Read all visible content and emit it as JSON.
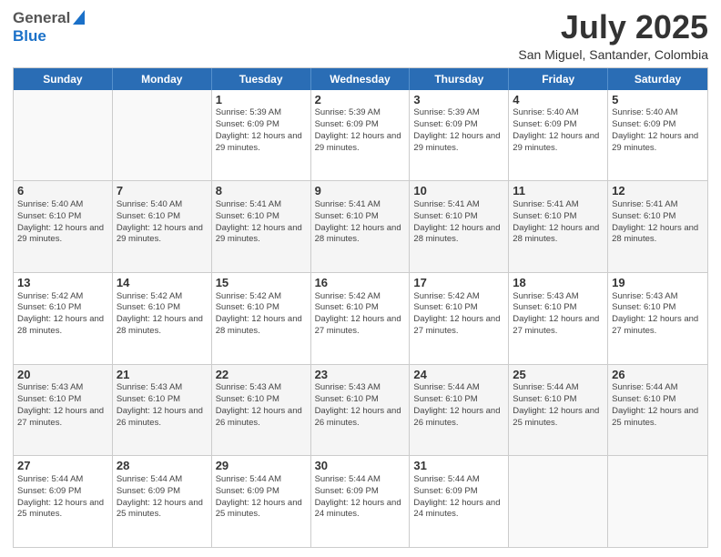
{
  "header": {
    "logo_general": "General",
    "logo_blue": "Blue",
    "month_title": "July 2025",
    "location": "San Miguel, Santander, Colombia"
  },
  "calendar": {
    "days_of_week": [
      "Sunday",
      "Monday",
      "Tuesday",
      "Wednesday",
      "Thursday",
      "Friday",
      "Saturday"
    ],
    "weeks": [
      [
        {
          "day": "",
          "sunrise": "",
          "sunset": "",
          "daylight": "",
          "empty": true
        },
        {
          "day": "",
          "sunrise": "",
          "sunset": "",
          "daylight": "",
          "empty": true
        },
        {
          "day": "1",
          "sunrise": "Sunrise: 5:39 AM",
          "sunset": "Sunset: 6:09 PM",
          "daylight": "Daylight: 12 hours and 29 minutes.",
          "empty": false
        },
        {
          "day": "2",
          "sunrise": "Sunrise: 5:39 AM",
          "sunset": "Sunset: 6:09 PM",
          "daylight": "Daylight: 12 hours and 29 minutes.",
          "empty": false
        },
        {
          "day": "3",
          "sunrise": "Sunrise: 5:39 AM",
          "sunset": "Sunset: 6:09 PM",
          "daylight": "Daylight: 12 hours and 29 minutes.",
          "empty": false
        },
        {
          "day": "4",
          "sunrise": "Sunrise: 5:40 AM",
          "sunset": "Sunset: 6:09 PM",
          "daylight": "Daylight: 12 hours and 29 minutes.",
          "empty": false
        },
        {
          "day": "5",
          "sunrise": "Sunrise: 5:40 AM",
          "sunset": "Sunset: 6:09 PM",
          "daylight": "Daylight: 12 hours and 29 minutes.",
          "empty": false
        }
      ],
      [
        {
          "day": "6",
          "sunrise": "Sunrise: 5:40 AM",
          "sunset": "Sunset: 6:10 PM",
          "daylight": "Daylight: 12 hours and 29 minutes.",
          "empty": false
        },
        {
          "day": "7",
          "sunrise": "Sunrise: 5:40 AM",
          "sunset": "Sunset: 6:10 PM",
          "daylight": "Daylight: 12 hours and 29 minutes.",
          "empty": false
        },
        {
          "day": "8",
          "sunrise": "Sunrise: 5:41 AM",
          "sunset": "Sunset: 6:10 PM",
          "daylight": "Daylight: 12 hours and 29 minutes.",
          "empty": false
        },
        {
          "day": "9",
          "sunrise": "Sunrise: 5:41 AM",
          "sunset": "Sunset: 6:10 PM",
          "daylight": "Daylight: 12 hours and 28 minutes.",
          "empty": false
        },
        {
          "day": "10",
          "sunrise": "Sunrise: 5:41 AM",
          "sunset": "Sunset: 6:10 PM",
          "daylight": "Daylight: 12 hours and 28 minutes.",
          "empty": false
        },
        {
          "day": "11",
          "sunrise": "Sunrise: 5:41 AM",
          "sunset": "Sunset: 6:10 PM",
          "daylight": "Daylight: 12 hours and 28 minutes.",
          "empty": false
        },
        {
          "day": "12",
          "sunrise": "Sunrise: 5:41 AM",
          "sunset": "Sunset: 6:10 PM",
          "daylight": "Daylight: 12 hours and 28 minutes.",
          "empty": false
        }
      ],
      [
        {
          "day": "13",
          "sunrise": "Sunrise: 5:42 AM",
          "sunset": "Sunset: 6:10 PM",
          "daylight": "Daylight: 12 hours and 28 minutes.",
          "empty": false
        },
        {
          "day": "14",
          "sunrise": "Sunrise: 5:42 AM",
          "sunset": "Sunset: 6:10 PM",
          "daylight": "Daylight: 12 hours and 28 minutes.",
          "empty": false
        },
        {
          "day": "15",
          "sunrise": "Sunrise: 5:42 AM",
          "sunset": "Sunset: 6:10 PM",
          "daylight": "Daylight: 12 hours and 28 minutes.",
          "empty": false
        },
        {
          "day": "16",
          "sunrise": "Sunrise: 5:42 AM",
          "sunset": "Sunset: 6:10 PM",
          "daylight": "Daylight: 12 hours and 27 minutes.",
          "empty": false
        },
        {
          "day": "17",
          "sunrise": "Sunrise: 5:42 AM",
          "sunset": "Sunset: 6:10 PM",
          "daylight": "Daylight: 12 hours and 27 minutes.",
          "empty": false
        },
        {
          "day": "18",
          "sunrise": "Sunrise: 5:43 AM",
          "sunset": "Sunset: 6:10 PM",
          "daylight": "Daylight: 12 hours and 27 minutes.",
          "empty": false
        },
        {
          "day": "19",
          "sunrise": "Sunrise: 5:43 AM",
          "sunset": "Sunset: 6:10 PM",
          "daylight": "Daylight: 12 hours and 27 minutes.",
          "empty": false
        }
      ],
      [
        {
          "day": "20",
          "sunrise": "Sunrise: 5:43 AM",
          "sunset": "Sunset: 6:10 PM",
          "daylight": "Daylight: 12 hours and 27 minutes.",
          "empty": false
        },
        {
          "day": "21",
          "sunrise": "Sunrise: 5:43 AM",
          "sunset": "Sunset: 6:10 PM",
          "daylight": "Daylight: 12 hours and 26 minutes.",
          "empty": false
        },
        {
          "day": "22",
          "sunrise": "Sunrise: 5:43 AM",
          "sunset": "Sunset: 6:10 PM",
          "daylight": "Daylight: 12 hours and 26 minutes.",
          "empty": false
        },
        {
          "day": "23",
          "sunrise": "Sunrise: 5:43 AM",
          "sunset": "Sunset: 6:10 PM",
          "daylight": "Daylight: 12 hours and 26 minutes.",
          "empty": false
        },
        {
          "day": "24",
          "sunrise": "Sunrise: 5:44 AM",
          "sunset": "Sunset: 6:10 PM",
          "daylight": "Daylight: 12 hours and 26 minutes.",
          "empty": false
        },
        {
          "day": "25",
          "sunrise": "Sunrise: 5:44 AM",
          "sunset": "Sunset: 6:10 PM",
          "daylight": "Daylight: 12 hours and 25 minutes.",
          "empty": false
        },
        {
          "day": "26",
          "sunrise": "Sunrise: 5:44 AM",
          "sunset": "Sunset: 6:10 PM",
          "daylight": "Daylight: 12 hours and 25 minutes.",
          "empty": false
        }
      ],
      [
        {
          "day": "27",
          "sunrise": "Sunrise: 5:44 AM",
          "sunset": "Sunset: 6:09 PM",
          "daylight": "Daylight: 12 hours and 25 minutes.",
          "empty": false
        },
        {
          "day": "28",
          "sunrise": "Sunrise: 5:44 AM",
          "sunset": "Sunset: 6:09 PM",
          "daylight": "Daylight: 12 hours and 25 minutes.",
          "empty": false
        },
        {
          "day": "29",
          "sunrise": "Sunrise: 5:44 AM",
          "sunset": "Sunset: 6:09 PM",
          "daylight": "Daylight: 12 hours and 25 minutes.",
          "empty": false
        },
        {
          "day": "30",
          "sunrise": "Sunrise: 5:44 AM",
          "sunset": "Sunset: 6:09 PM",
          "daylight": "Daylight: 12 hours and 24 minutes.",
          "empty": false
        },
        {
          "day": "31",
          "sunrise": "Sunrise: 5:44 AM",
          "sunset": "Sunset: 6:09 PM",
          "daylight": "Daylight: 12 hours and 24 minutes.",
          "empty": false
        },
        {
          "day": "",
          "sunrise": "",
          "sunset": "",
          "daylight": "",
          "empty": true
        },
        {
          "day": "",
          "sunrise": "",
          "sunset": "",
          "daylight": "",
          "empty": true
        }
      ]
    ]
  }
}
